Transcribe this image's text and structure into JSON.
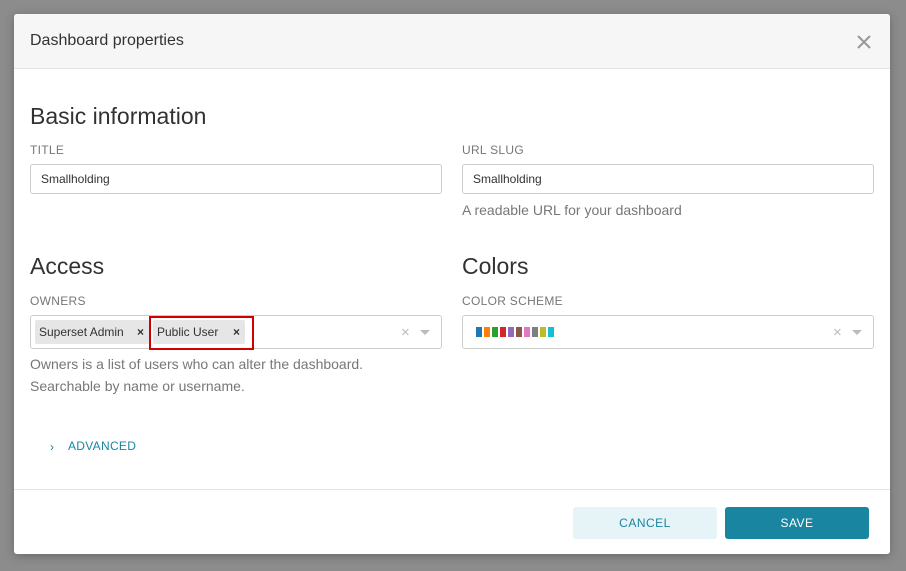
{
  "modal": {
    "title": "Dashboard properties"
  },
  "basic": {
    "heading": "Basic information",
    "title_label": "TITLE",
    "title_value": "Smallholding",
    "slug_label": "URL SLUG",
    "slug_value": "Smallholding",
    "slug_helper": "A readable URL for your dashboard"
  },
  "access": {
    "heading": "Access",
    "owners_label": "OWNERS",
    "owners": [
      "Superset Admin",
      "Public User"
    ],
    "owners_helper_line1": "Owners is a list of users who can alter the dashboard.",
    "owners_helper_line2": "Searchable by name or username."
  },
  "colors": {
    "heading": "Colors",
    "scheme_label": "COLOR SCHEME",
    "scheme_swatches": [
      "#1f77b4",
      "#ff7f0e",
      "#2ca02c",
      "#d62728",
      "#9467bd",
      "#8c564b",
      "#e377c2",
      "#7f7f7f",
      "#bcbd22",
      "#17becf"
    ]
  },
  "advanced": {
    "label": "ADVANCED"
  },
  "footer": {
    "cancel_label": "CANCEL",
    "save_label": "SAVE"
  },
  "theme": {
    "primary": "#1a85a0",
    "highlight": "#d00000"
  }
}
